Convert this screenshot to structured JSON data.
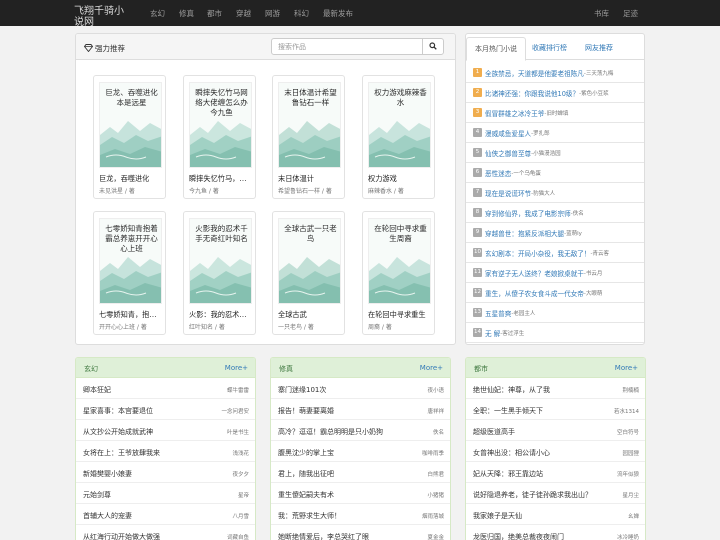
{
  "nav": {
    "brand": "飞翔千骑小说网",
    "items": [
      "玄幻",
      "修真",
      "都市",
      "穿越",
      "网游",
      "科幻",
      "最新发布"
    ],
    "right": [
      "书库",
      "足迹"
    ]
  },
  "recommend": {
    "title": "强力推荐",
    "search_placeholder": "搜索作品",
    "books": [
      {
        "title": "巨龙，吞噬进化",
        "author": "未见洪星 / 著",
        "cover_text": "巨龙、吞噬进化本是远星"
      },
      {
        "title": "瞬摔失忆竹马，网络大佬缠怎么办",
        "author": "今九鱼 / 著",
        "cover_text": "瞬摔失忆竹马网络大佬缠怎么办今九鱼"
      },
      {
        "title": "末日体温计",
        "author": "希望鲁钻石一样 / 著",
        "cover_text": "末日体温计希望鲁钻石一样"
      },
      {
        "title": "权力游戏",
        "author": "麻辣香水 / 著",
        "cover_text": "权力游戏麻辣香水"
      },
      {
        "title": "七零娇知青，抱着霸总夫养崽",
        "author": "开开心心上班 / 著",
        "cover_text": "七零娇知青抱着霸总养崽开开心心上班"
      },
      {
        "title": "火影：我的忍术千手无奇",
        "author": "红叶知名 / 著",
        "cover_text": "火影我的忍术千手无奇红叶知名"
      },
      {
        "title": "全球古武",
        "author": "一只老鸟 / 著",
        "cover_text": "全球古武一只老鸟"
      },
      {
        "title": "在轮回中寻求重生",
        "author": "周裔 / 著",
        "cover_text": "在轮回中寻求重生周裔"
      }
    ]
  },
  "hot": {
    "tabs": [
      "本月热门小说",
      "收藏排行榜",
      "网友推荐"
    ],
    "items": [
      {
        "rank": "1",
        "title": "全族禁忌，天道都是他要老祖陈凡",
        "author": "-三天荡九梅"
      },
      {
        "rank": "2",
        "title": "比诸神还强：你跟我说他10级？",
        "author": "-紫色小豆浆"
      },
      {
        "rank": "3",
        "title": "假冒群雄之冰冷王爷",
        "author": "-旧时蝉填"
      },
      {
        "rank": "4",
        "title": "漫威咸鱼爱星人",
        "author": "-罗扎郎"
      },
      {
        "rank": "5",
        "title": "仙侠之御兽至尊",
        "author": "-小猫漫浩园"
      },
      {
        "rank": "6",
        "title": "恶性迷恋",
        "author": "-一个乌龟蛋"
      },
      {
        "rank": "7",
        "title": "现在是说谎环节",
        "author": "-豹猫大人"
      },
      {
        "rank": "8",
        "title": "穿到修仙界，我成了电影宗师",
        "author": "-佚名"
      },
      {
        "rank": "9",
        "title": "穿越兽世：抱紧反派相大腿",
        "author": "-蓝萌ly"
      },
      {
        "rank": "10",
        "title": "玄幻剧本：开局小杂役，我无敌了！",
        "author": "-青云客"
      },
      {
        "rank": "11",
        "title": "家有逆子无人送终？老娘掀桌就干",
        "author": "-书云月"
      },
      {
        "rank": "12",
        "title": "重生，从傻子农女食斗成一代女帝",
        "author": "-大眼萌"
      },
      {
        "rank": "13",
        "title": "五星普爽",
        "author": "-老园主人"
      },
      {
        "rank": "14",
        "title": "无 解",
        "author": "-客过浮生"
      }
    ]
  },
  "categories": [
    {
      "name": "玄幻",
      "more": "More+",
      "rows": [
        {
          "title": "卿本狂妃",
          "author": "蝶牛雷雷"
        },
        {
          "title": "星家喜事：本宫要退位",
          "author": "一念问君安"
        },
        {
          "title": "从文抄公开始成就武神",
          "author": "叶是书生"
        },
        {
          "title": "女将在上：王爷放肆我来",
          "author": "浅浅花"
        },
        {
          "title": "新婚樊婴小娘妻",
          "author": "夜夕夕"
        },
        {
          "title": "元始剑尊",
          "author": "星帝"
        },
        {
          "title": "首辅大人的宠妻",
          "author": "八月雪"
        },
        {
          "title": "从红海行动开始做大做强",
          "author": "词藏自鱼"
        }
      ]
    },
    {
      "name": "修真",
      "more": "More+",
      "rows": [
        {
          "title": "寨门迷缘101次",
          "author": "夜小语"
        },
        {
          "title": "报告！萌妻要离婚",
          "author": "唐祥祥"
        },
        {
          "title": "高冷？逗逗！霸总明明是只小奶狗",
          "author": "佚名"
        },
        {
          "title": "腹黑沈少的掌上宝",
          "author": "咖啡雨季"
        },
        {
          "title": "君上，随我出征吧",
          "author": "白熊君"
        },
        {
          "title": "重生傻妃嗣夫有术",
          "author": "小猪猪"
        },
        {
          "title": "我：荒野求生大师！",
          "author": "烟雨落城"
        },
        {
          "title": "她断绝情爱后，李总哭红了眼",
          "author": "夏金金"
        }
      ]
    },
    {
      "name": "都市",
      "more": "More+",
      "rows": [
        {
          "title": "绝世仙妃：神尊，从了我",
          "author": "荆楠楠"
        },
        {
          "title": "全职：一生黑手倾天下",
          "author": "若水1314"
        },
        {
          "title": "超级医道高手",
          "author": "空白符号"
        },
        {
          "title": "女曾神出没：相公请小心",
          "author": "园园狸"
        },
        {
          "title": "妃从天降：邪王靠边站",
          "author": "流年似狼"
        },
        {
          "title": "说好隐退养老，徒子徒孙跪求我出山？",
          "author": "星月尘"
        },
        {
          "title": "我家娘子是天仙",
          "author": "幺婵"
        },
        {
          "title": "龙医归国，绝美总裁夜夜闹门",
          "author": "冰冷睡奶"
        }
      ]
    }
  ]
}
